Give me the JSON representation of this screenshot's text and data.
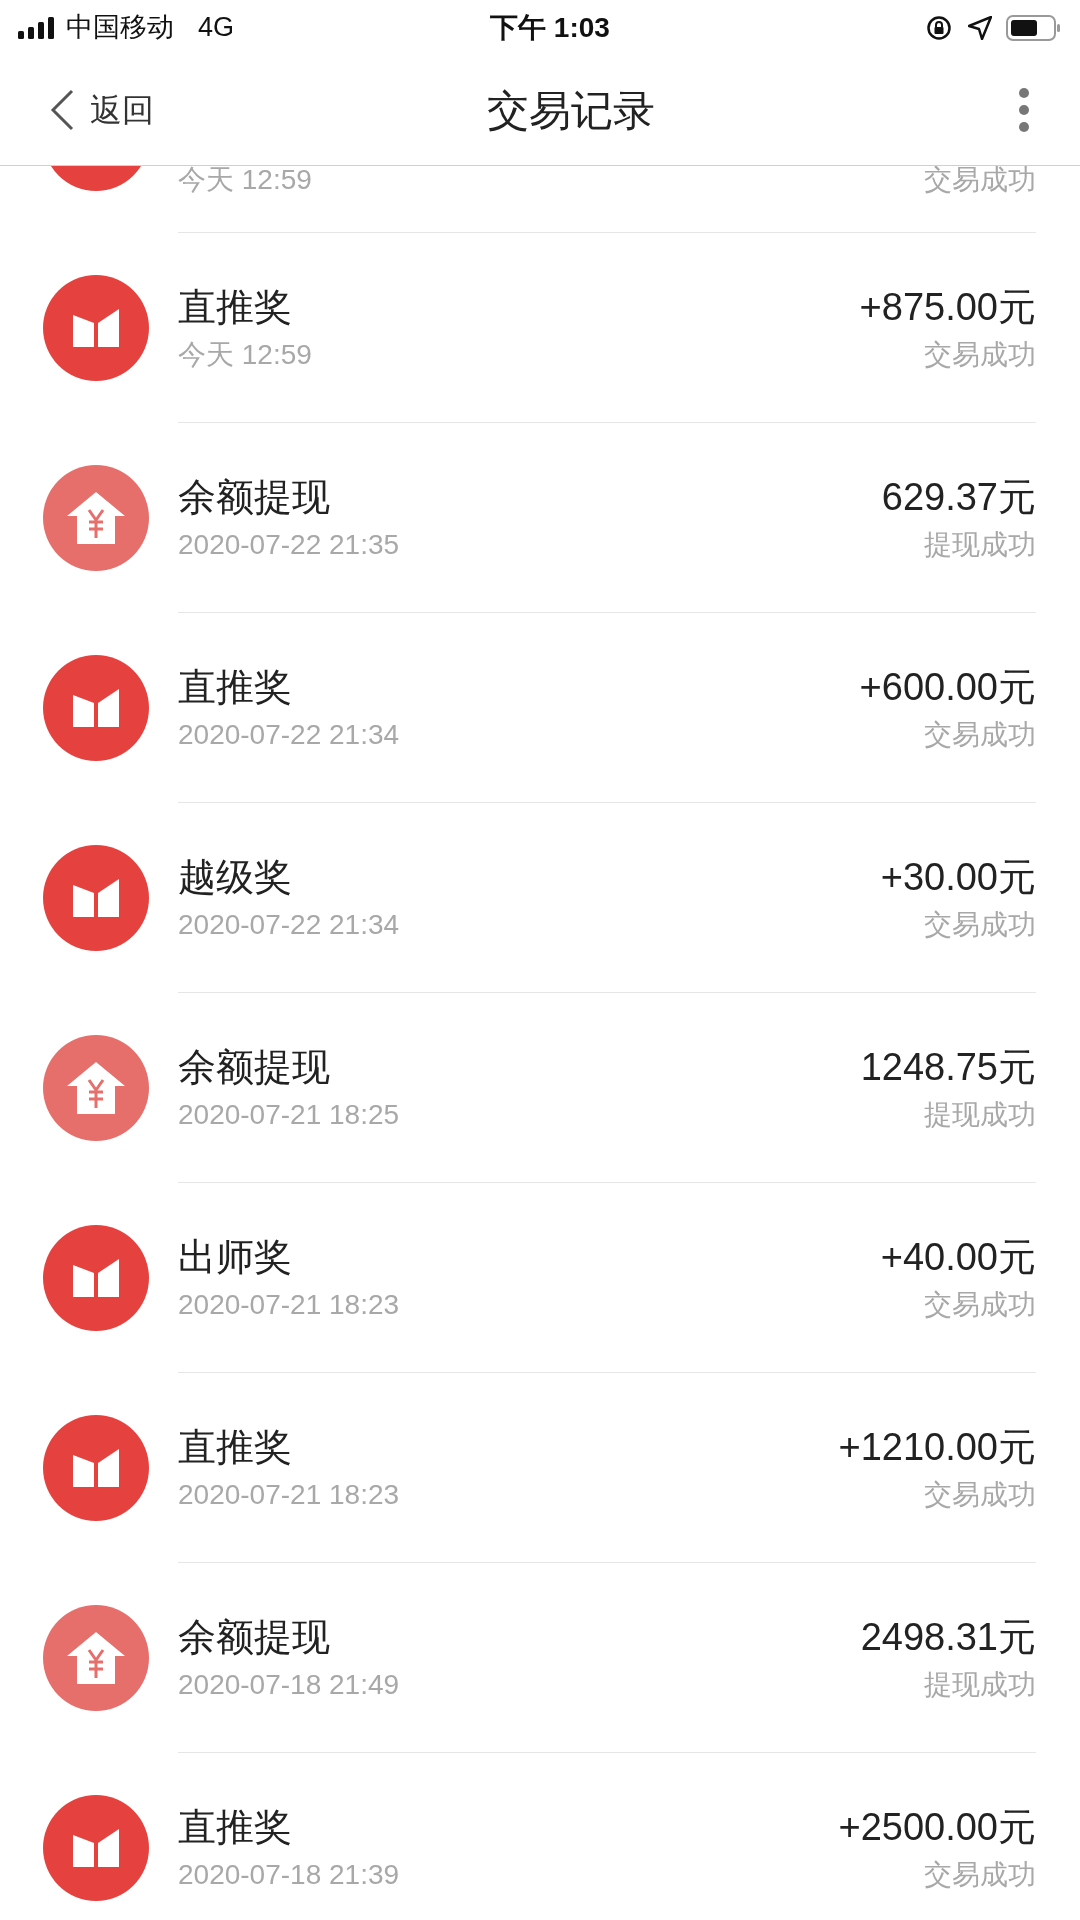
{
  "status_bar": {
    "carrier": "中国移动",
    "network": "4G",
    "time": "下午 1:03"
  },
  "nav": {
    "back": "返回",
    "title": "交易记录"
  },
  "records": [
    {
      "kind": "reward",
      "partial": true,
      "date": "今天 12:59",
      "status": "交易成功"
    },
    {
      "kind": "reward",
      "title": "直推奖",
      "date": "今天 12:59",
      "amount": "+875.00元",
      "status": "交易成功"
    },
    {
      "kind": "withdraw",
      "title": "余额提现",
      "date": "2020-07-22 21:35",
      "amount": "629.37元",
      "status": "提现成功"
    },
    {
      "kind": "reward",
      "title": "直推奖",
      "date": "2020-07-22 21:34",
      "amount": "+600.00元",
      "status": "交易成功"
    },
    {
      "kind": "reward",
      "title": "越级奖",
      "date": "2020-07-22 21:34",
      "amount": "+30.00元",
      "status": "交易成功"
    },
    {
      "kind": "withdraw",
      "title": "余额提现",
      "date": "2020-07-21 18:25",
      "amount": "1248.75元",
      "status": "提现成功"
    },
    {
      "kind": "reward",
      "title": "出师奖",
      "date": "2020-07-21 18:23",
      "amount": "+40.00元",
      "status": "交易成功"
    },
    {
      "kind": "reward",
      "title": "直推奖",
      "date": "2020-07-21 18:23",
      "amount": "+1210.00元",
      "status": "交易成功"
    },
    {
      "kind": "withdraw",
      "title": "余额提现",
      "date": "2020-07-18 21:49",
      "amount": "2498.31元",
      "status": "提现成功"
    },
    {
      "kind": "reward",
      "title": "直推奖",
      "date": "2020-07-18 21:39",
      "amount": "+2500.00元",
      "status": "交易成功"
    }
  ]
}
